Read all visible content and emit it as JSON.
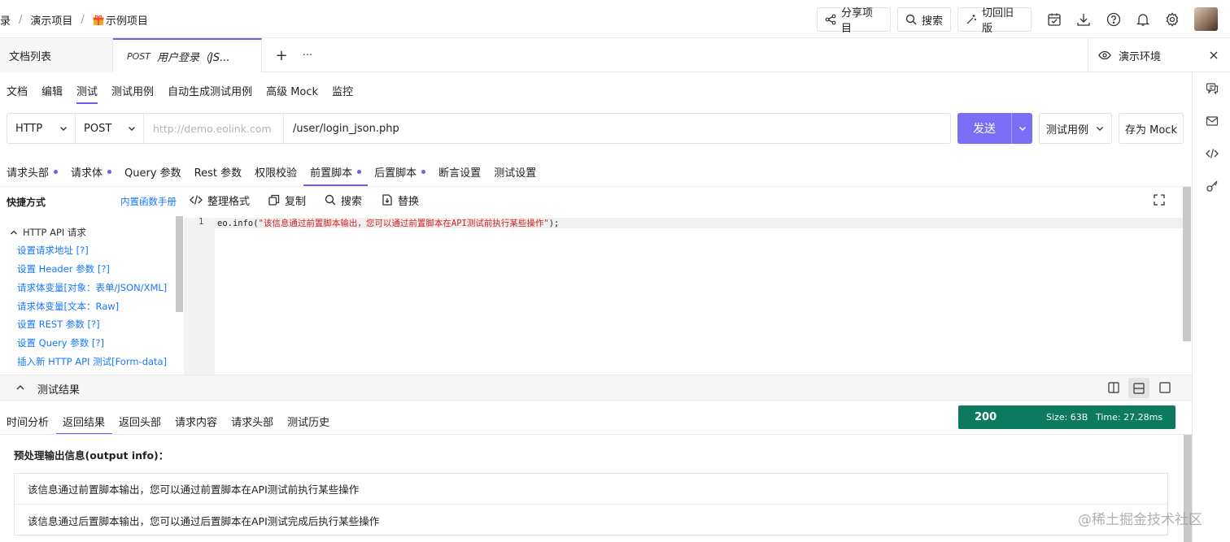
{
  "breadcrumb": {
    "root": "录",
    "project_group": "演示项目",
    "project_icon": "gift-icon",
    "project": "示例项目"
  },
  "toolbar": {
    "share_label": "分享项目",
    "search_label": "搜索",
    "switch_label": "切回旧版"
  },
  "doc_tabs": {
    "list_label": "文档列表",
    "active_method": "POST",
    "active_title": "用户登录（JS...",
    "add": "+",
    "more": "···"
  },
  "environment": {
    "label": "演示环境"
  },
  "subnav": [
    "文档",
    "编辑",
    "测试",
    "测试用例",
    "自动生成测试用例",
    "高级 Mock",
    "监控"
  ],
  "subnav_active": "测试",
  "request": {
    "protocol": "HTTP",
    "method": "POST",
    "host_placeholder": "http://demo.eolink.com",
    "path": "/user/login_json.php",
    "send_label": "发送",
    "test_case_label": "测试用例",
    "save_mock_label": "存为 Mock"
  },
  "request_tabs": [
    {
      "label": "请求头部",
      "dot": true
    },
    {
      "label": "请求体",
      "dot": true
    },
    {
      "label": "Query 参数",
      "dot": false
    },
    {
      "label": "Rest 参数",
      "dot": false
    },
    {
      "label": "权限校验",
      "dot": false
    },
    {
      "label": "前置脚本",
      "dot": true,
      "active": true
    },
    {
      "label": "后置脚本",
      "dot": true
    },
    {
      "label": "断言设置",
      "dot": false
    },
    {
      "label": "测试设置",
      "dot": false
    }
  ],
  "shortcuts": {
    "title": "快捷方式",
    "manual_link": "内置函数手册",
    "group": "HTTP API 请求",
    "items": [
      "设置请求地址 [?]",
      "设置 Header 参数 [?]",
      "请求体变量[对象：表单/JSON/XML]",
      "请求体变量[文本：Raw]",
      "设置 REST 参数 [?]",
      "设置 Query 参数 [?]",
      "插入新 HTTP API 测试[Form-data]"
    ]
  },
  "editor_tools": {
    "format": "整理格式",
    "copy": "复制",
    "search": "搜索",
    "replace": "替换"
  },
  "code": {
    "line_number": "1",
    "prefix": "eo.info(",
    "string": "\"该信息通过前置脚本输出，您可以通过前置脚本在API测试前执行某些操作\"",
    "suffix": ");"
  },
  "results": {
    "title": "测试结果",
    "tabs": [
      "时间分析",
      "返回结果",
      "返回头部",
      "请求内容",
      "请求头部",
      "测试历史"
    ],
    "active_tab": "返回结果",
    "status_code": "200",
    "size": "Size:  63B",
    "time": "Time:  27.28ms",
    "output_heading": "预处理输出信息(output info)：",
    "output_lines": [
      "该信息通过前置脚本输出，您可以通过前置脚本在API测试前执行某些操作",
      "该信息通过后置脚本输出，您可以通过后置脚本在API测试完成后执行某些操作"
    ]
  },
  "watermark": "@稀土掘金技术社区",
  "colors": {
    "accent": "#6b5cf6",
    "send_button": "#7b6ef6",
    "status_ok": "#0c7a5f",
    "link": "#1677ff",
    "code_string": "#d42020"
  }
}
